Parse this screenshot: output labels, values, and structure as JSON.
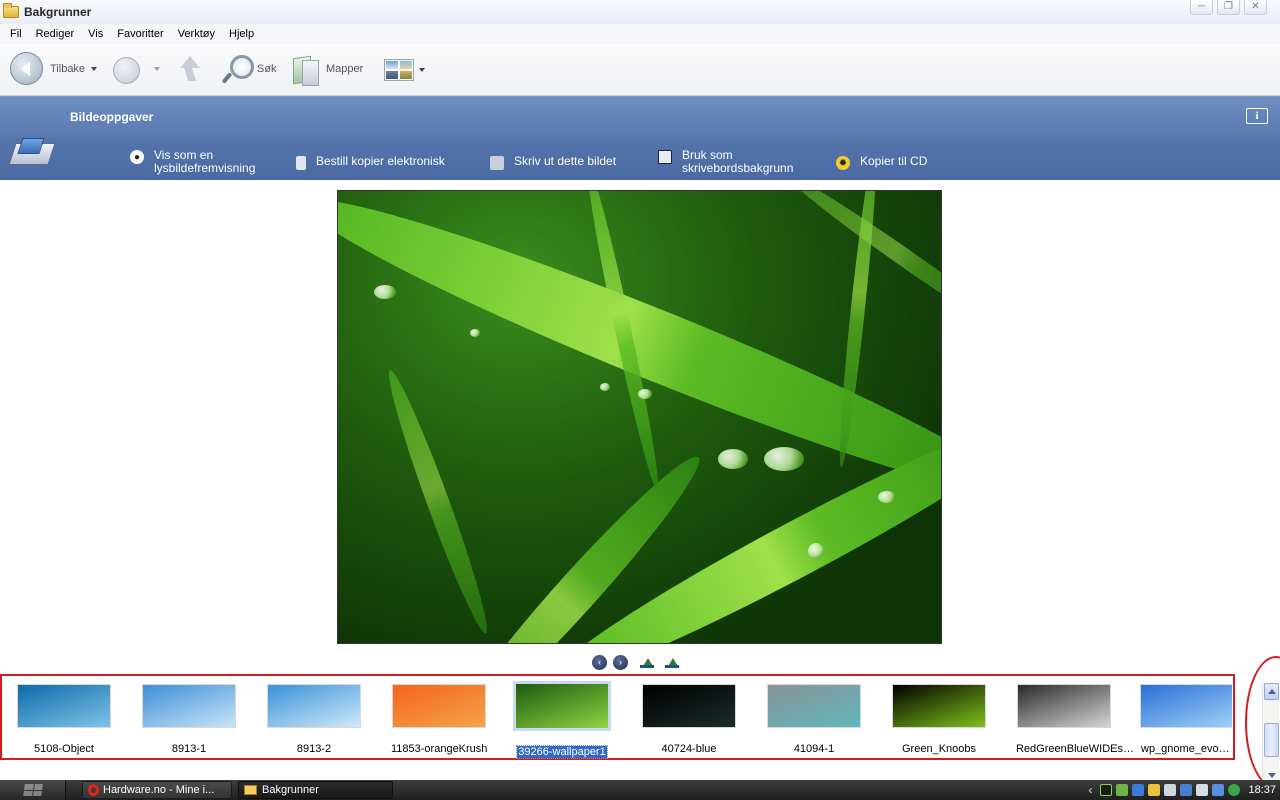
{
  "window": {
    "title": "Bakgrunner",
    "controls": [
      "─",
      "❐",
      "✕"
    ]
  },
  "menubar": {
    "items": [
      "Fil",
      "Rediger",
      "Vis",
      "Favoritter",
      "Verktøy",
      "Hjelp"
    ]
  },
  "toolbar": {
    "back_label": "Tilbake",
    "search_label": "Søk",
    "folders_label": "Mapper"
  },
  "tasks": {
    "title": "Bildeoppgaver",
    "items": [
      {
        "line1": "Vis som en",
        "line2": "lysbildefremvisning"
      },
      {
        "line1": "Bestill kopier elektronisk",
        "line2": ""
      },
      {
        "line1": "Skriv ut dette bildet",
        "line2": ""
      },
      {
        "line1": "Bruk som",
        "line2": "skrivebordsbakgrunn"
      },
      {
        "line1": "Kopier til CD",
        "line2": ""
      }
    ]
  },
  "filmstrip": {
    "thumbnails": [
      {
        "label": "5108-Object",
        "colors": [
          "#0e6aa8",
          "#7fc4e8"
        ]
      },
      {
        "label": "8913-1",
        "colors": [
          "#3d8fd6",
          "#c8e4f8"
        ]
      },
      {
        "label": "8913-2",
        "colors": [
          "#3a92d8",
          "#cfe8f9"
        ]
      },
      {
        "label": "11853-orangeKrush",
        "colors": [
          "#f2661a",
          "#f7a14a"
        ]
      },
      {
        "label": "39266-wallpaper1",
        "colors": [
          "#1d5a0c",
          "#8fd545"
        ],
        "selected": true
      },
      {
        "label": "40724-blue",
        "colors": [
          "#000000",
          "#1c2c2a"
        ]
      },
      {
        "label": "41094-1",
        "colors": [
          "#8a9497",
          "#5fb6bd"
        ]
      },
      {
        "label": "Green_Knoobs",
        "colors": [
          "#000000",
          "#7fc21a"
        ]
      },
      {
        "label": "RedGreenBlueWIDEsc...",
        "colors": [
          "#2a2a2a",
          "#d6d6d6"
        ]
      },
      {
        "label": "wp_gnome_evolve",
        "colors": [
          "#2a6fd8",
          "#9fd0f4"
        ]
      }
    ]
  },
  "taskbar": {
    "buttons": [
      "Hardware.no - Mine i...",
      "Bakgrunner"
    ],
    "clock": "18:37"
  }
}
